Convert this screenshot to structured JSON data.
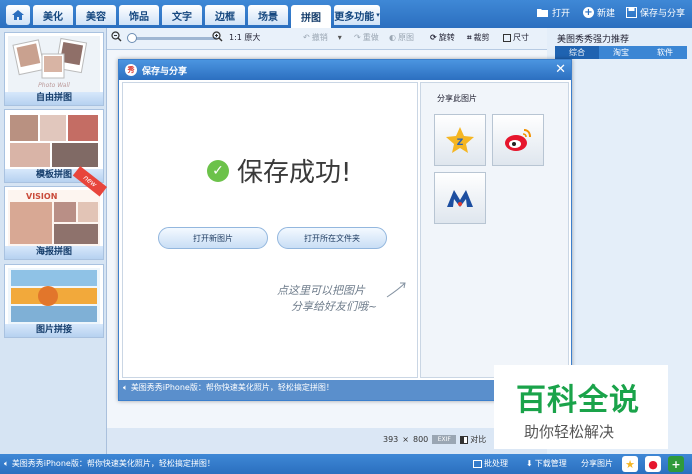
{
  "topbar": {
    "tabs": [
      {
        "label": "美化"
      },
      {
        "label": "美容"
      },
      {
        "label": "饰品"
      },
      {
        "label": "文字"
      },
      {
        "label": "边框"
      },
      {
        "label": "场景"
      },
      {
        "label": "拼图"
      },
      {
        "label": "更多功能"
      }
    ],
    "active_tab": "拼图",
    "open_label": "打开",
    "new_label": "新建",
    "save_share_label": "保存与分享"
  },
  "toolbar": {
    "original_size": "1:1 原大",
    "undo": "撤销",
    "redo": "重做",
    "original": "原图",
    "rotate": "旋转",
    "crop": "裁剪",
    "size": "尺寸"
  },
  "left_panel": {
    "items": [
      {
        "label": "自由拼图",
        "overlay": "Photo Wall"
      },
      {
        "label": "模板拼图"
      },
      {
        "label": "海报拼图",
        "overlay": "VISION",
        "badge": "new"
      },
      {
        "label": "图片拼接"
      }
    ]
  },
  "right_panel": {
    "title": "美图秀秀强力推荐",
    "tabs": [
      "综合",
      "淘宝",
      "软件"
    ]
  },
  "dialog": {
    "logo": "秀",
    "title": "保存与分享",
    "success": "保存成功!",
    "open_new": "打开新图片",
    "open_folder": "打开所在文件夹",
    "handwriting_line1": "点这里可以把图片",
    "handwriting_line2": "分享给好友们哦~",
    "share_title": "分享此图片",
    "bottom_text": "美图秀秀iPhone版：帮你快速美化照片，轻松搞定拼图！"
  },
  "canvas_info": {
    "width": "393",
    "times": "×",
    "height": "800",
    "compare": "对比"
  },
  "watermark": {
    "main": "百科全说",
    "sub": "助你轻松解决"
  },
  "statusbar": {
    "text": "美图秀秀iPhone版：帮你快速美化照片，轻松搞定拼图！",
    "batch": "批处理",
    "downloads": "下载管理",
    "share": "分享图片"
  },
  "colors": {
    "brand_blue": "#2b6fbf",
    "success_green": "#6cc24a",
    "watermark_green": "#1aa34a"
  }
}
